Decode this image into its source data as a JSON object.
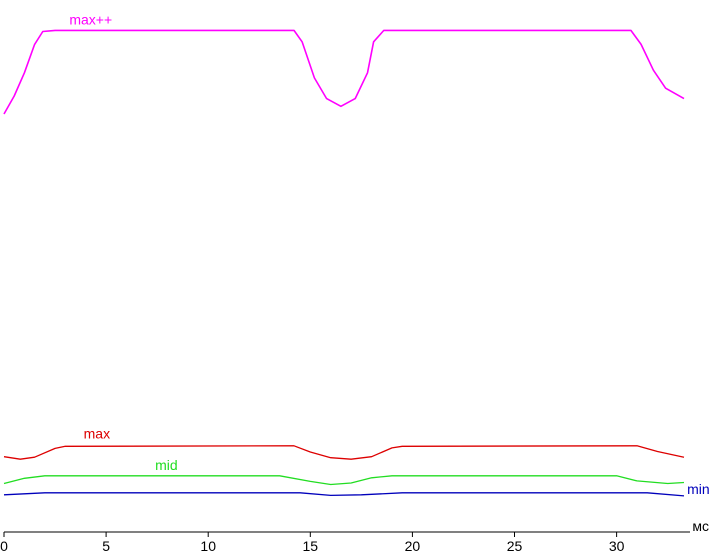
{
  "chart_data": {
    "type": "line",
    "xlabel": "мс",
    "xlim": [
      0,
      33.3
    ],
    "ylim": [
      0,
      100
    ],
    "x_ticks": [
      0,
      5,
      10,
      15,
      20,
      25,
      30
    ],
    "x_tick_labels": [
      "0",
      "5",
      "10",
      "15",
      "20",
      "25",
      "30"
    ],
    "grid": false,
    "series": [
      {
        "name": "max++",
        "color": "#ff00ff",
        "points": [
          [
            0,
            81
          ],
          [
            0.5,
            84.5
          ],
          [
            1,
            89
          ],
          [
            1.5,
            94.5
          ],
          [
            1.9,
            97
          ],
          [
            2.5,
            97.2
          ],
          [
            14.2,
            97.2
          ],
          [
            14.6,
            95
          ],
          [
            15.2,
            88
          ],
          [
            15.8,
            84
          ],
          [
            16.5,
            82.5
          ],
          [
            17.2,
            84
          ],
          [
            17.8,
            89
          ],
          [
            18.1,
            95
          ],
          [
            18.6,
            97.2
          ],
          [
            30.7,
            97.2
          ],
          [
            31.2,
            94.5
          ],
          [
            31.8,
            89.5
          ],
          [
            32.4,
            86
          ],
          [
            33.3,
            84
          ]
        ]
      },
      {
        "name": "max",
        "color": "#dd0000",
        "points": [
          [
            0,
            14.6
          ],
          [
            0.8,
            14.1
          ],
          [
            1.5,
            14.5
          ],
          [
            2.5,
            16.2
          ],
          [
            3,
            16.6
          ],
          [
            14.2,
            16.7
          ],
          [
            15,
            15.5
          ],
          [
            16,
            14.4
          ],
          [
            17,
            14.1
          ],
          [
            18,
            14.6
          ],
          [
            19,
            16.3
          ],
          [
            19.5,
            16.6
          ],
          [
            31,
            16.7
          ],
          [
            32,
            15.6
          ],
          [
            33.3,
            14.5
          ]
        ]
      },
      {
        "name": "mid",
        "color": "#22dd22",
        "points": [
          [
            0,
            9.4
          ],
          [
            1,
            10.4
          ],
          [
            2,
            10.9
          ],
          [
            13.5,
            10.9
          ],
          [
            15,
            9.8
          ],
          [
            16,
            9.2
          ],
          [
            17,
            9.5
          ],
          [
            18,
            10.5
          ],
          [
            19,
            10.9
          ],
          [
            30,
            10.9
          ],
          [
            31,
            9.9
          ],
          [
            32.5,
            9.4
          ],
          [
            33.3,
            9.6
          ]
        ]
      },
      {
        "name": "min",
        "color": "#0000bb",
        "points": [
          [
            0,
            7.2
          ],
          [
            2,
            7.6
          ],
          [
            14.5,
            7.6
          ],
          [
            16,
            7.1
          ],
          [
            17.5,
            7.2
          ],
          [
            19.5,
            7.6
          ],
          [
            31.5,
            7.6
          ],
          [
            33.3,
            7.0
          ]
        ]
      }
    ],
    "labels": [
      {
        "series": "max++",
        "text": "max++"
      },
      {
        "series": "max",
        "text": "max"
      },
      {
        "series": "mid",
        "text": "mid"
      },
      {
        "series": "min",
        "text": "min"
      }
    ]
  }
}
